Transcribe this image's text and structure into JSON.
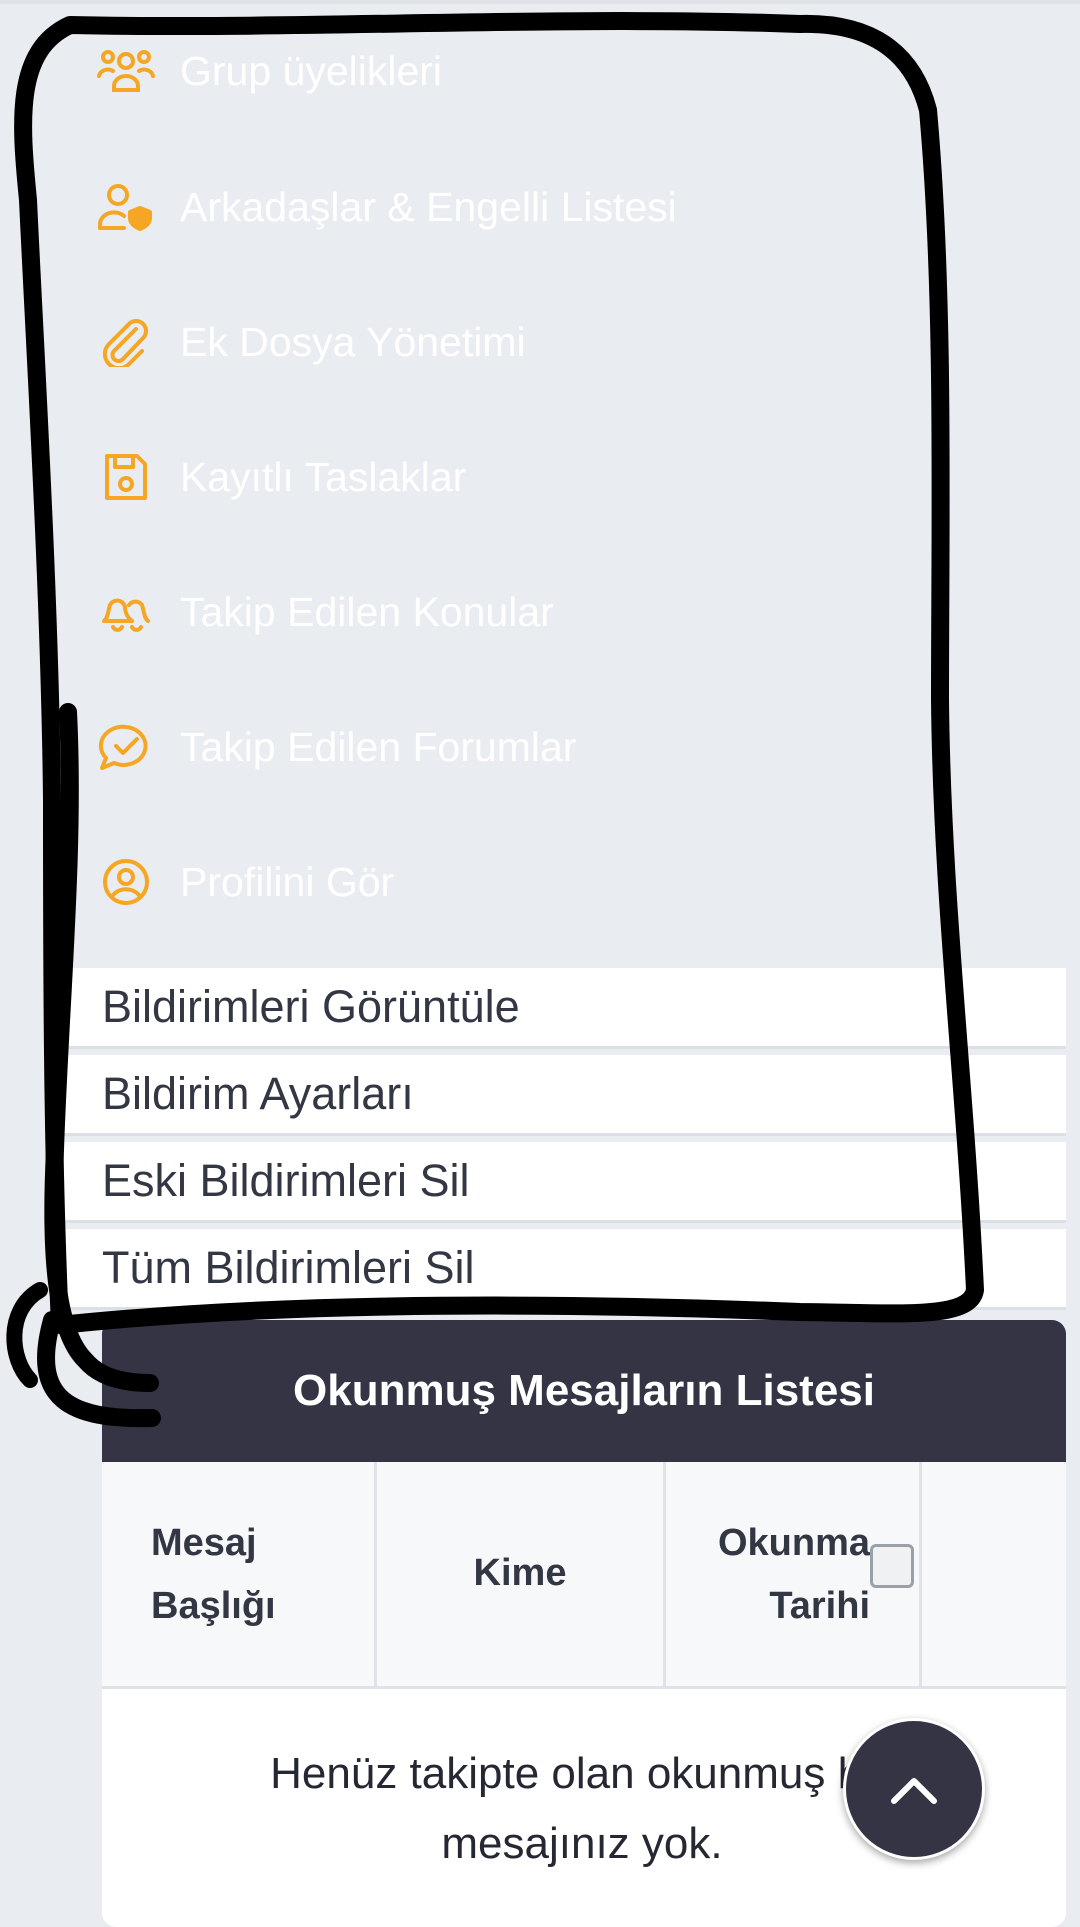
{
  "menu": {
    "items": [
      {
        "label": "Grup üyelikleri",
        "icon": "group-icon"
      },
      {
        "label": "Arkadaşlar & Engelli Listesi",
        "icon": "user-shield-icon"
      },
      {
        "label": "Ek Dosya Yönetimi",
        "icon": "paperclip-icon"
      },
      {
        "label": "Kayıtlı Taslaklar",
        "icon": "floppy-disk-icon"
      },
      {
        "label": "Takip Edilen Konular",
        "icon": "bells-icon"
      },
      {
        "label": "Takip Edilen Forumlar",
        "icon": "chat-check-icon"
      },
      {
        "label": "Profilini Gör",
        "icon": "user-circle-icon"
      }
    ]
  },
  "notifications": {
    "actions": [
      {
        "label": "Bildirimleri Görüntüle"
      },
      {
        "label": "Bildirim Ayarları"
      },
      {
        "label": "Eski Bildirimleri Sil"
      },
      {
        "label": "Tüm Bildirimleri Sil"
      }
    ]
  },
  "panel": {
    "title": "Okunmuş Mesajların Listesi",
    "columns": {
      "subject_line1": "Mesaj",
      "subject_line2": "Başlığı",
      "to": "Kime",
      "read_date_line1": "Okunma",
      "read_date_line2": "Tarihi"
    },
    "empty_line1": "Henüz takipte olan okunmuş hiç",
    "empty_line2": "mesajınız yok."
  },
  "colors": {
    "page_bg": "#e9ecf0",
    "icon_orange": "#f5a623",
    "panel_header": "#353445",
    "annotation_ink": "#000000"
  }
}
